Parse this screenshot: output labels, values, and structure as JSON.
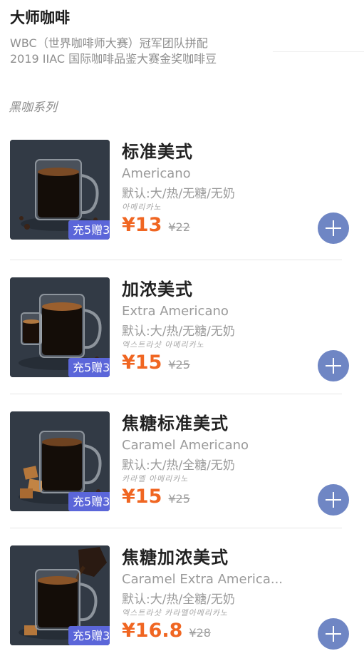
{
  "store": {
    "title": "大师咖啡",
    "subtitle_line1": "WBC（世界咖啡师大赛）冠军团队拼配",
    "subtitle_line2": "2019 IIAC 国际咖啡品鉴大赛金奖咖啡豆"
  },
  "section": {
    "title": "黑咖系列"
  },
  "products": [
    {
      "name": "标准美式",
      "name_en": "Americano",
      "spec": "默认:大/热/无糖/无奶",
      "korean": "아메리카노",
      "price": "¥13",
      "original_price": "¥22",
      "promo": "充5赠3",
      "add_icon": "plus-icon"
    },
    {
      "name": "加浓美式",
      "name_en": "Extra Americano",
      "spec": "默认:大/热/无糖/无奶",
      "korean": "엑스트라샷 아메리카노",
      "price": "¥15",
      "original_price": "¥25",
      "promo": "充5赠3",
      "add_icon": "plus-icon"
    },
    {
      "name": "焦糖标准美式",
      "name_en": "Caramel Americano",
      "spec": "默认:大/热/全糖/无奶",
      "korean": "카라멜 아메리카노",
      "price": "¥15",
      "original_price": "¥25",
      "promo": "充5赠3",
      "add_icon": "plus-icon"
    },
    {
      "name": "焦糖加浓美式",
      "name_en": "Caramel Extra America...",
      "spec": "默认:大/热/全糖/无奶",
      "korean": "엑스트라샷 카라멜아메리카노",
      "price": "¥16.8",
      "original_price": "¥28",
      "promo": "充5赠3",
      "add_icon": "plus-icon"
    }
  ],
  "colors": {
    "accent_price": "#f06622",
    "promo_bg": "#5b66d9",
    "add_button": "#6f86c4"
  }
}
